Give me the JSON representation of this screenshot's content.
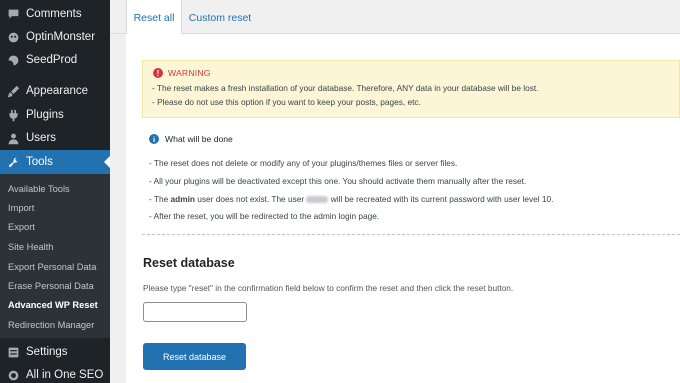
{
  "sidebar": {
    "menu": [
      {
        "label": "Comments",
        "icon": "comments-icon"
      },
      {
        "label": "OptinMonster",
        "icon": "optinmonster-icon"
      },
      {
        "label": "SeedProd",
        "icon": "seedprod-icon"
      },
      {
        "label": "Appearance",
        "icon": "appearance-icon"
      },
      {
        "label": "Plugins",
        "icon": "plugins-icon"
      },
      {
        "label": "Users",
        "icon": "users-icon"
      },
      {
        "label": "Tools",
        "icon": "tools-icon",
        "active": true
      }
    ],
    "submenu": [
      "Available Tools",
      "Import",
      "Export",
      "Site Health",
      "Export Personal Data",
      "Erase Personal Data",
      "Advanced WP Reset",
      "Redirection Manager"
    ],
    "submenu_current": "Advanced WP Reset",
    "menu_after": [
      {
        "label": "Settings",
        "icon": "settings-icon"
      },
      {
        "label": "All in One SEO",
        "icon": "aioseo-icon"
      }
    ]
  },
  "tabs": [
    {
      "label": "Reset all",
      "active": true
    },
    {
      "label": "Custom reset",
      "active": false
    }
  ],
  "warning": {
    "icon_glyph": "!",
    "title": "WARNING",
    "lines": [
      "- The reset makes a fresh installation of your database. Therefore, ANY data in your database will be lost.",
      "- Please do not use this option if you want to keep your posts, pages, etc."
    ]
  },
  "info": {
    "icon_glyph": "i",
    "title": "What will be done",
    "lines": [
      "- The reset does not delete or modify any of your plugins/themes files or server files.",
      "- All your plugins will be deactivated except this one. You should activate them manually after the reset.",
      "- After the reset, you will be redirected to the admin login page."
    ],
    "admin_line_a": "- The ",
    "admin_line_b": "admin",
    "admin_line_c": " user does not exist. The user ",
    "admin_line_d": " will be recreated with its current password with user level 10."
  },
  "reset": {
    "heading": "Reset database",
    "description": "Please type \"reset\" in the confirmation field below to confirm the reset and then click the reset button.",
    "input_value": "",
    "button_label": "Reset database"
  },
  "colors": {
    "sidebar_bg": "#1d2327",
    "submenu_bg": "#2c3338",
    "accent": "#2271b1",
    "warning_bg": "#fcf6d6",
    "warning_red": "#d63638"
  }
}
